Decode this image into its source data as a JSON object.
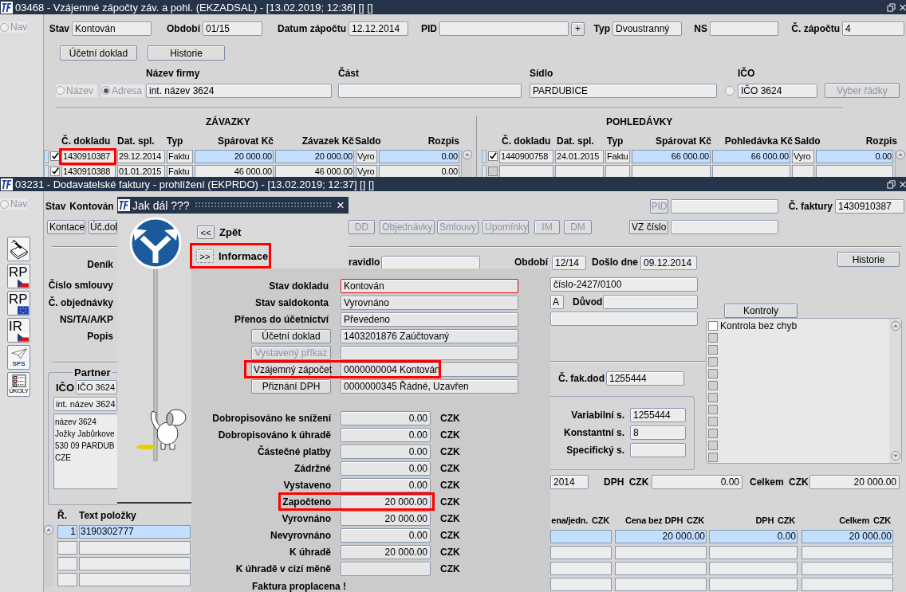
{
  "top_window": {
    "title": "03468 - Vzájemné zápočty záv. a pohl. (EKZADSAL) - [13.02.2019; 12:36] [] []",
    "nav": {
      "label": "Nav",
      "selected": false
    },
    "header_fields": [
      {
        "label": "Stav",
        "value": "Kontován"
      },
      {
        "label": "Období",
        "value": "01/15"
      },
      {
        "label": "Datum zápočtu",
        "value": "12.12.2014"
      },
      {
        "label": "PID",
        "button": "+"
      },
      {
        "label": "Typ",
        "value": "Dvoustranný"
      },
      {
        "label": "NS"
      },
      {
        "label": "Č. zápočtu",
        "value": "4"
      }
    ],
    "buttons": [
      "Účetní doklad",
      "Historie"
    ],
    "search_by": [
      {
        "label": "Název",
        "selected": false
      },
      {
        "label": "Adresa",
        "selected": true
      }
    ],
    "firm_fields": [
      {
        "label": "Název firmy",
        "value": "int. název 3624"
      },
      {
        "label": "Část"
      },
      {
        "label": "Sídlo",
        "value": "PARDUBICE"
      },
      {
        "label": "IČO",
        "value": "IČO 3624",
        "radio_selected": false
      }
    ],
    "select_rows_button": {
      "label": "Vyber řádky",
      "disabled": true
    },
    "liabilities": {
      "title": "ZÁVAZKY",
      "columns": [
        "Č. dokladu",
        "Dat. spl.",
        "Typ",
        "Spárovat Kč",
        "Závazek Kč",
        "Saldo",
        "Rozpis"
      ],
      "rows": [
        {
          "selected": true,
          "checked": true,
          "marked": true,
          "cells": [
            "1430910387",
            "29.12.2014",
            "Faktu",
            "20 000.00",
            "20 000.00",
            "Vyro",
            "0.00"
          ]
        },
        {
          "selected": false,
          "checked": true,
          "marked": false,
          "cells": [
            "1430910388",
            "01.01.2015",
            "Faktu",
            "46 000.00",
            "46 000.00",
            "Vyro",
            "0.00"
          ]
        }
      ]
    },
    "receivables": {
      "title": "POHLEDÁVKY",
      "columns": [
        "Č. dokladu",
        "Dat. spl.",
        "Typ",
        "Spárovat Kč",
        "Pohledávka Kč",
        "Saldo",
        "Rozpis"
      ],
      "rows": [
        {
          "selected": true,
          "checked": true,
          "marked": false,
          "cells": [
            "1440900758",
            "24.01.2015",
            "Faktu",
            "66 000.00",
            "66 000.00",
            "Vyro",
            "0.00"
          ]
        },
        {
          "selected": false,
          "checked": false,
          "marked": false
        }
      ]
    }
  },
  "bottom_window": {
    "title": "03231 - Dodavatelské faktury - prohlížení (EKPRDO) - [13.02.2019; 12:37] [] []",
    "nav": {
      "label": "Nav",
      "selected": false
    },
    "side_buttons": [
      {
        "kind": "pen"
      },
      {
        "kind": "rp_cz",
        "label": "RP"
      },
      {
        "kind": "rp_eu",
        "label": "RP"
      },
      {
        "kind": "ir_cz",
        "label": "IR"
      },
      {
        "kind": "sps",
        "label": "SPS"
      },
      {
        "kind": "tasks",
        "label": "ÚKOLY"
      }
    ],
    "status": {
      "label": "Stav",
      "value": "Kontován"
    },
    "left_buttons": [
      {
        "label": "Kontace",
        "disabled": false
      },
      {
        "label": "Úč.dol",
        "disabled": false
      }
    ],
    "right_buttons": [
      {
        "label": "DD",
        "disabled": true
      },
      {
        "label": "Objednávky",
        "disabled": true
      },
      {
        "label": "Smlouvy",
        "disabled": true
      },
      {
        "label": "Upomínky",
        "disabled": true
      },
      {
        "label": "IM",
        "disabled": true
      },
      {
        "label": "DM",
        "disabled": true
      }
    ],
    "pid": {
      "label": "PID",
      "disabled": true
    },
    "invoice_number": {
      "label": "Č. faktury",
      "value": "1430910387"
    },
    "vz_button": {
      "label": "VZ číslo",
      "disabled": false
    },
    "left_labels": [
      "Deník",
      "Číslo smlouvy",
      "Č. objednávky",
      "NS/TA/A/KP",
      "Popis"
    ],
    "rule_label": "ravidlo",
    "period": {
      "label": "Období",
      "value": "12/14"
    },
    "received": {
      "label": "Došlo dne",
      "value": "09.12.2014"
    },
    "history_button": "Historie",
    "contract_value": "číslo-2427/0100",
    "flag_value": "A",
    "reason": {
      "label": "Důvod"
    },
    "checks": {
      "button": "Kontroly",
      "items": [
        {
          "label": "Kontrola bez chyb",
          "checked": false,
          "disabled": false
        },
        {
          "checked": false,
          "disabled": true
        },
        {
          "checked": false,
          "disabled": true
        },
        {
          "checked": false,
          "disabled": true
        },
        {
          "checked": false,
          "disabled": true
        },
        {
          "checked": false,
          "disabled": true
        },
        {
          "checked": false,
          "disabled": true
        },
        {
          "checked": false,
          "disabled": true
        },
        {
          "checked": false,
          "disabled": true
        },
        {
          "checked": false,
          "disabled": true
        },
        {
          "checked": false,
          "disabled": true
        },
        {
          "checked": false,
          "disabled": true
        }
      ]
    },
    "partner": {
      "title": "Partner",
      "ico_label": "IČO",
      "ico": "IČO 3624",
      "name": "int. název 3624",
      "address": [
        "název 3624",
        "Jožky Jabůrkove",
        "530 09 PARDUB",
        "CZE"
      ]
    },
    "supplier_invoice": {
      "label": "Č. fak.dod",
      "value": "1255444"
    },
    "symbols": [
      {
        "label": "Variabilní s.",
        "value": "1255444"
      },
      {
        "label": "Konstantní s.",
        "value": "8"
      },
      {
        "label": "Specifický s."
      }
    ],
    "date_fragment": "2014",
    "vat_total": {
      "label": "DPH",
      "currency": "CZK",
      "value": "0.00"
    },
    "grand_total": {
      "label": "Celkem",
      "currency": "CZK",
      "value": "20 000.00"
    },
    "items": {
      "columns": [
        {
          "label": "Ř."
        },
        {
          "label": "Text položky"
        },
        {
          "label": "ena/jedn.",
          "currency": "CZK"
        },
        {
          "label": "Cena bez DPH",
          "currency": "CZK"
        },
        {
          "label": "DPH",
          "currency": "CZK"
        },
        {
          "label": "Celkem",
          "currency": "CZK"
        }
      ],
      "rows": [
        {
          "selected": true,
          "number": "1",
          "text": "3190302777",
          "net": "20 000.00",
          "vat": "0.00",
          "total": "20 000.00"
        },
        {
          "selected": false
        },
        {
          "selected": false
        },
        {
          "selected": false
        }
      ]
    }
  },
  "dialog": {
    "title": "Jak dál ???",
    "close": "×",
    "back": {
      "symbol": "<<",
      "label": "Zpět"
    },
    "info": {
      "symbol": ">>",
      "label": "Informace",
      "marked": true
    },
    "status_rows": [
      {
        "kind": "field",
        "label": "Stav dokladu",
        "value": "Kontován",
        "focused": true
      },
      {
        "kind": "field",
        "label": "Stav saldokonta",
        "value": "Vyrovnáno",
        "focused": false
      },
      {
        "kind": "field",
        "label": "Přenos do účetnictví",
        "value": "Převedeno",
        "focused": false
      },
      {
        "kind": "button",
        "label": "Účetní doklad",
        "value": "1403201876 Zaúčtovaný",
        "disabled": false,
        "marked": false
      },
      {
        "kind": "button",
        "label": "Vystavený příkaz",
        "disabled": true,
        "marked": false
      },
      {
        "kind": "button",
        "label": "Vzájemný zápočet",
        "value": "0000000004 Kontován",
        "disabled": false,
        "marked": true
      },
      {
        "kind": "button",
        "label": "Přiznání DPH",
        "value": "0000000345 Řádné, Uzavřen",
        "disabled": false,
        "marked": false
      }
    ],
    "amounts": [
      {
        "label": "Dobropisováno ke snížení",
        "value": "0.00",
        "currency": "CZK",
        "marked": false
      },
      {
        "label": "Dobropisováno k úhradě",
        "value": "0.00",
        "currency": "CZK",
        "marked": false
      },
      {
        "label": "Částečné platby",
        "value": "0.00",
        "currency": "CZK",
        "marked": false
      },
      {
        "label": "Zádržné",
        "value": "0.00",
        "currency": "CZK",
        "marked": false
      },
      {
        "label": "Vystaveno",
        "value": "0.00",
        "currency": "CZK",
        "marked": false
      },
      {
        "label": "Započteno",
        "value": "20 000.00",
        "currency": "CZK",
        "marked": true
      },
      {
        "label": "Vyrovnáno",
        "value": "20 000.00",
        "currency": "CZK",
        "marked": false
      },
      {
        "label": "Nevyrovnáno",
        "value": "0.00",
        "currency": "CZK",
        "marked": false
      },
      {
        "label": "K úhradě",
        "value": "20 000.00",
        "currency": "CZK",
        "marked": false
      },
      {
        "label": "K úhradě v cizí měně",
        "currency": "CZK",
        "marked": false
      }
    ],
    "note": "Faktura proplacena !"
  }
}
